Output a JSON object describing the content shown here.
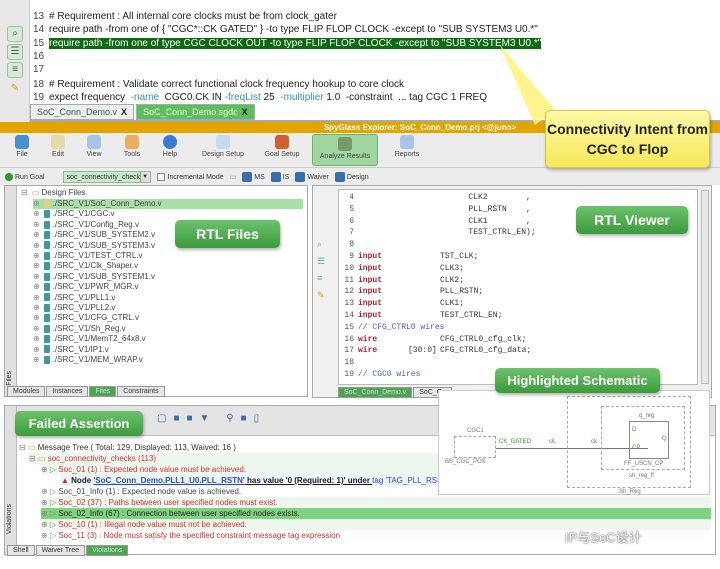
{
  "editor": {
    "lines": [
      {
        "num": "13",
        "text": "# Requirement : All internal core clocks must be from clock_gater"
      },
      {
        "num": "14",
        "text": "require path -from one of { \"CGC*::CK GATED\" } -to type FLIP FLOP CLOCK -except to \"SUB SYSTEM3 U0.*\""
      },
      {
        "num": "15",
        "text": "require path -from one of type CGC CLOCK OUT -to type FLIP FLOP CLOCK -except to \"SUB SYSTEM3 U0.*\""
      },
      {
        "num": "16",
        "text": ""
      },
      {
        "num": "17",
        "text": ""
      },
      {
        "num": "18",
        "text": "# Requirement : Validate correct functional clock frequency hookup to core clock"
      },
      {
        "num": "19",
        "pre": "expect frequency  ",
        "o1": "-name",
        "m1": "  CGC0.CK IN ",
        "o2": "-freqList",
        "m2": " 25  ",
        "o3": "-multiplier",
        "m3": " 1.0  -constraint  ... tag CGC 1 FREQ"
      }
    ],
    "tabs": [
      "SoC_Conn_Demo.v",
      "SoC_Conn_Demo.sgdc"
    ],
    "close": "X"
  },
  "callouts": {
    "intent": "Connectivity Intent from CGC to Flop",
    "rtl_files": "RTL Files",
    "rtl_viewer": "RTL Viewer",
    "schematic": "Highlighted Schematic",
    "failed": "Failed Assertion"
  },
  "window": {
    "title": "SpyGlass Explorer: SoC_Conn_Demo.prj <@juno>"
  },
  "toolbar": {
    "items": [
      "File",
      "Edit",
      "View",
      "Tools",
      "Help",
      "Design Setup",
      "Goal Setup",
      "Analyze Results",
      "Reports"
    ],
    "run_goal": "Run Goal",
    "goal_value": "soc_connectivity_checks",
    "incremental": "Incremental Mode",
    "ms": "MS",
    "is": "IS",
    "waiver": "Waiver",
    "design": "Design"
  },
  "files": {
    "root": "Design Files",
    "items": [
      "./SRC_V1/SoC_Conn_Demo.v",
      "./SRC_V1/CGC.v",
      "./SRC_V1/Config_Reg.v",
      "./SRC_V1/SUB_SYSTEM2.v",
      "./SRC_V1/SUB_SYSTEM3.v",
      "./SRC_V1/TEST_CTRL.v",
      "./SRC_V1/Clk_Shaper.v",
      "./SRC_V1/SUB_SYSTEM1.v",
      "./SRC_V1/PWR_MGR.v",
      "./SRC_V1/PLL1.v",
      "./SRC_V1/PLL2.v",
      "./SRC_V1/CFG_CTRL.v",
      "./SRC_V1/Sh_Reg.v",
      "./SRC_V1/MemT2_64x8.v",
      "./SRC_V1/IP1.v",
      "./SRC_V1/MEM_WRAP.v"
    ],
    "side_label": "Files",
    "tabs": [
      "Modules",
      "Instances",
      "Files",
      "Constraints"
    ]
  },
  "viewer": {
    "lines": [
      {
        "num": "4",
        "kw": "",
        "width": "",
        "text": "                       CLK2        ,"
      },
      {
        "num": "5",
        "kw": "",
        "width": "",
        "text": "                       PLL_RSTN    ,"
      },
      {
        "num": "6",
        "kw": "",
        "width": "",
        "text": "                       CLK1        ,"
      },
      {
        "num": "7",
        "kw": "",
        "width": "",
        "text": "                       TEST_CTRL_EN);"
      },
      {
        "num": "8",
        "kw": "",
        "width": "",
        "text": ""
      },
      {
        "num": "9",
        "kw": "input",
        "width": "",
        "text": "TST_CLK;"
      },
      {
        "num": "10",
        "kw": "input",
        "width": "",
        "text": "CLK3;"
      },
      {
        "num": "11",
        "kw": "input",
        "width": "",
        "text": "CLK2;"
      },
      {
        "num": "12",
        "kw": "input",
        "width": "",
        "text": "PLL_RSTN;"
      },
      {
        "num": "13",
        "kw": "input",
        "width": "",
        "text": "CLK1;"
      },
      {
        "num": "14",
        "kw": "input",
        "width": "",
        "text": "TEST_CTRL_EN;"
      },
      {
        "num": "15",
        "kw": "",
        "width": "",
        "comment": "// CFG_CTRL0 wires"
      },
      {
        "num": "16",
        "kw": "wire",
        "width": "",
        "text": "CFG_CTRL0_cfg_clk;"
      },
      {
        "num": "17",
        "kw": "wire",
        "width": "[30:0]",
        "text": "CFG_CTRL0_cfg_data;"
      },
      {
        "num": "18",
        "kw": "",
        "width": "",
        "text": ""
      },
      {
        "num": "19",
        "kw": "",
        "width": "",
        "comment": "// CGC0 wires"
      }
    ],
    "tabs": [
      "SoC_Conn_Demo.v",
      "SoC_Co"
    ]
  },
  "schematic": {
    "cgc": "CGC1",
    "cgc_type": "BB_CGC_POS",
    "net": "CK_GATED",
    "pin1": "ck",
    "pin2": "ck",
    "reg": "q_reg",
    "d": "D",
    "cp": "CP",
    "q": "Q",
    "ff_type": "FF_USCN_CP",
    "inst": "sh_reg_ff",
    "module": "Sh_Reg"
  },
  "messages": {
    "tree": "Message Tree ( Total: 129, Displayed: 113, Waived: 16 )",
    "goal": "soc_connectivity_checks (113)",
    "items": [
      {
        "text": "Soc_01 (1) : Expected node value must be achieved.",
        "status": "error"
      },
      {
        "text": "Soc_01_Info (1) : Expected node value is achieved.",
        "status": "info"
      },
      {
        "text": "Soc_02 (37) : Paths between user specified nodes must exist.",
        "status": "error"
      },
      {
        "text": "Soc_02_Info (67) : Connection between user specified nodes exists.",
        "status": "info"
      },
      {
        "text": "Soc_10 (1) : Illegal node value must not be achieved.",
        "status": "error"
      },
      {
        "text": "Soc_11 (3) : Node must satisfy the specified constraint message tag expression",
        "status": "error"
      }
    ],
    "violation": {
      "pre": "Node ",
      "node": "'SoC_Conn_Demo.PLL1_U0.PLL_RSTN'",
      "mid": " has value '0 (Required: 1)' under ",
      "tag": "tag 'TAG_PLL_RS"
    },
    "side_label": "Violations",
    "tabs": [
      "Shell",
      "Waiver Tree",
      "Violations"
    ]
  },
  "watermark": "IP与SoC设计",
  "colors": {
    "title_bar": "#e4a400",
    "highlight": "#0b6a12",
    "callout_green": "#4caf50",
    "callout_yellow": "#fff27a",
    "error": "#d83030"
  }
}
